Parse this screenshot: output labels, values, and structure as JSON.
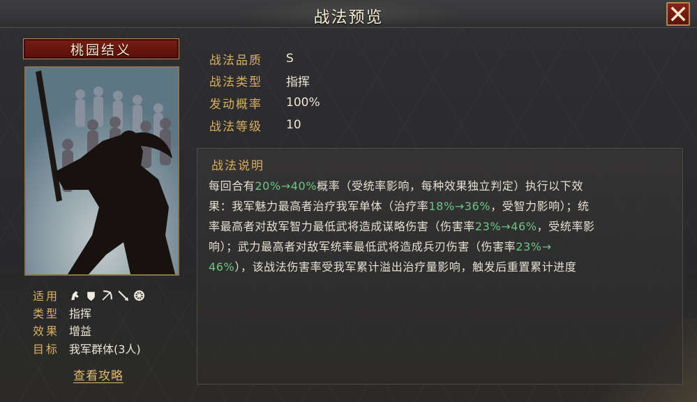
{
  "window": {
    "title": "战法预览"
  },
  "skill": {
    "name": "桃园结义",
    "attributes": [
      {
        "label": "适用",
        "value": "",
        "icons": [
          "cavalry-icon",
          "shield-icon",
          "bow-icon",
          "spear-icon",
          "wheel-icon"
        ]
      },
      {
        "label": "类型",
        "value": "指挥"
      },
      {
        "label": "效果",
        "value": "增益"
      },
      {
        "label": "目标",
        "value": "我军群体(3人)"
      }
    ],
    "guide_link": "查看攻略"
  },
  "info": [
    {
      "label": "战法品质",
      "value": "S"
    },
    {
      "label": "战法类型",
      "value": "指挥"
    },
    {
      "label": "发动概率",
      "value": "100%"
    },
    {
      "label": "战法等级",
      "value": "10"
    }
  ],
  "description": {
    "heading": "战法说明",
    "lines": [
      [
        {
          "t": "每回合有"
        },
        {
          "t": "20%→40%",
          "hl": true
        },
        {
          "t": "概率（受统率影响，每种效果独立判定）执行以下效"
        }
      ],
      [
        {
          "t": "果：我军魅力最高者治疗我军单体（治疗率"
        },
        {
          "t": "18%→36%",
          "hl": true
        },
        {
          "t": "，受智力影响）；统"
        }
      ],
      [
        {
          "t": "率最高者对敌军智力最低武将造成谋略伤害（伤害率"
        },
        {
          "t": "23%→46%",
          "hl": true
        },
        {
          "t": "，受统率影"
        }
      ],
      [
        {
          "t": "响）；武力最高者对敌军统率最低武将造成兵刃伤害（伤害率"
        },
        {
          "t": "23%→",
          "hl": true
        }
      ],
      [
        {
          "t": "46%",
          "hl": true
        },
        {
          "t": "），该战法伤害率受我军累计溢出治疗量影响，触发后重置累计进度"
        }
      ]
    ]
  },
  "colors": {
    "label_gold": "#d9b060",
    "highlight_green": "#6cc685",
    "banner_red": "#7a1e12"
  }
}
